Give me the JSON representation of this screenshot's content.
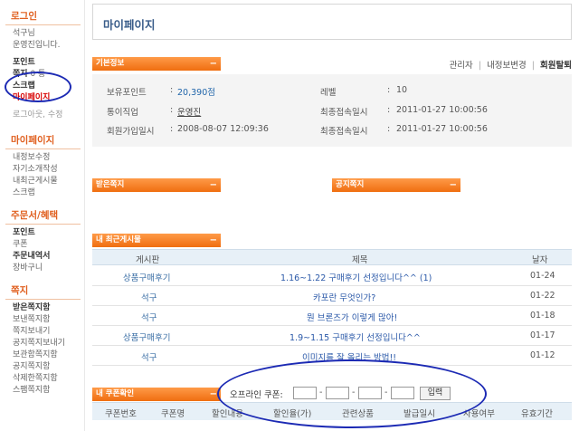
{
  "sidebar": {
    "login_title": "로그인",
    "user_line1": "석구님",
    "user_line2": "운영진입니다.",
    "point_label": "포인트",
    "note_label": "쪽지",
    "note_count": "0 통",
    "scrap": "스크랩",
    "mypage": "마이페이지",
    "logout_modify": "로그아웃, 수정",
    "section_mypage": "마이페이지",
    "mypage_items": [
      "내정보수정",
      "자기소개작성",
      "내최근게시물",
      "스크랩"
    ],
    "section_order": "주문서/혜택",
    "order_items": [
      "포인트",
      "쿠폰",
      "주문내역서",
      "장바구니"
    ],
    "section_note": "쪽지",
    "note_items": [
      "받은쪽지함",
      "보낸쪽지함",
      "쪽지보내기",
      "공지쪽지보내기",
      "보관함쪽지함",
      "공지쪽지함",
      "삭제한쪽지함",
      "스팸쪽지함"
    ]
  },
  "main": {
    "page_title": "마이페이지",
    "tab_basic": "기본정보",
    "tab_minus": "−",
    "links": {
      "admin": "관리자",
      "edit": "내정보변경",
      "withdraw": "회원탈퇴",
      "sep": "|"
    },
    "info": {
      "point_label": "보유포인트",
      "point_value": "20,390점",
      "level_label": "레벨",
      "level_value": "10",
      "job_label": "통이직업",
      "job_value": "운영진",
      "last_login_label": "최종접속일시",
      "last_login_value": "2011-01-27 10:00:56",
      "join_label": "회원가입일시",
      "join_value": "2008-08-07 12:09:36",
      "last_login2_label": "최종접속일시",
      "last_login2_value": "2011-01-27 10:00:56",
      "colon": ":"
    },
    "tab_received": "받은쪽지",
    "tab_notice": "공지쪽지",
    "tab_recent": "내 최근게시물",
    "board_headers": [
      "게시판",
      "제목",
      "날자"
    ],
    "board_rows": [
      {
        "board": "상품구매후기",
        "title": "1.16~1.22 구매후기 선정입니다^^ (1)",
        "date": "01-24"
      },
      {
        "board": "석구",
        "title": "카포란 무엇인가?",
        "date": "01-22"
      },
      {
        "board": "석구",
        "title": "뭔 브론즈가 이렇게 많아!",
        "date": "01-18"
      },
      {
        "board": "상품구매후기",
        "title": "1.9~1.15 구매후기 선정입니다^^",
        "date": "01-17"
      },
      {
        "board": "석구",
        "title": "이미지를 잘 올리는 방법!!",
        "date": "01-12"
      }
    ],
    "tab_coupon": "내 쿠폰확인",
    "offline_label": "오프라인 쿠폰:",
    "offline_dash": "-",
    "offline_button": "입력",
    "coupon_headers": [
      "쿠폰번호",
      "쿠폰명",
      "할인내용",
      "할인율(가)",
      "관련상품",
      "발급일시",
      "사용여부",
      "유효기간"
    ],
    "annotation_color": "#1c2ab4"
  }
}
